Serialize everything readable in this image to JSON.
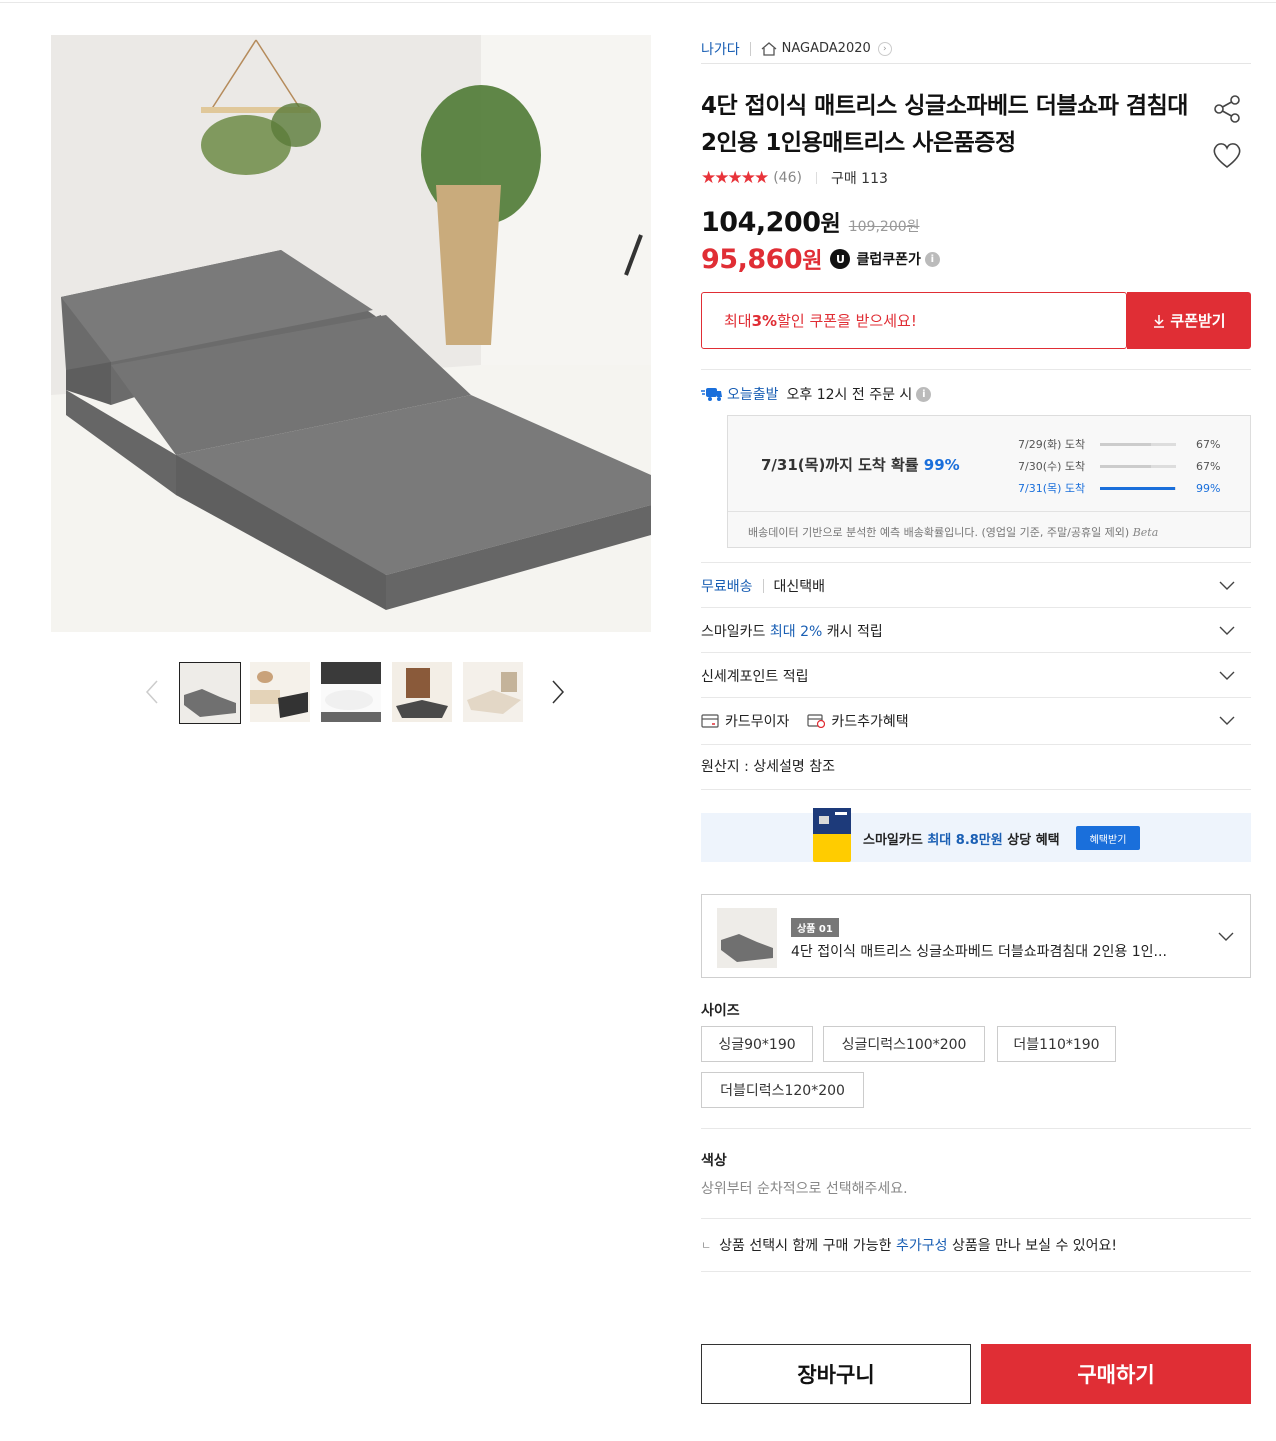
{
  "seller": {
    "brand": "나가다",
    "store": "NAGADA2020"
  },
  "product": {
    "title": "4단 접이식 매트리스 싱글소파베드 더블쇼파 겸침대 2인용 1인용매트리스 사은품증정",
    "rating_stars": "★★★★★",
    "rating_value": 4.5,
    "review_count": "(46)",
    "purchases": "구매 113"
  },
  "price": {
    "sale": "104,200",
    "sale_unit": "원",
    "original": "109,200원",
    "coupon": "95,860",
    "coupon_unit": "원",
    "coupon_badge": "U",
    "coupon_label": "클럽쿠폰가",
    "info_icon": "i"
  },
  "coupon_banner": {
    "prefix": "최대 ",
    "percent": "3%",
    "suffix": " 할인 쿠폰을 받으세요!",
    "button": "쿠폰받기"
  },
  "shipping": {
    "today_label": "오늘출발",
    "today_text": "오후 12시 전 주문 시",
    "arrival_prefix": "7/31(목)까지 도착 확률 ",
    "arrival_pct": "99%",
    "rows": [
      {
        "date": "7/29(화) 도착",
        "pct": "67%",
        "value": 67
      },
      {
        "date": "7/30(수) 도착",
        "pct": "67%",
        "value": 67
      },
      {
        "date": "7/31(목) 도착",
        "pct": "99%",
        "value": 99
      }
    ],
    "note": "배송데이터 기반으로 분석한 예측 배송확률입니다. (영업일 기준, 주말/공휴일 제외)",
    "beta": "Beta"
  },
  "benefits": {
    "free_ship": "무료배송",
    "courier": "대신택배",
    "smile_prefix": "스마일카드 ",
    "smile_blue": "최대 2%",
    "smile_suffix": " 캐시 적립",
    "shinsegae": "신세계포인트 적립",
    "card_interest": "카드무이자",
    "card_extra": "카드추가혜택",
    "origin": "원산지 : 상세설명 참조"
  },
  "smile_banner": {
    "prefix": "스마일카드 ",
    "blue": "최대 8.8만원",
    "suffix": " 상당 혜택",
    "button": "혜택받기"
  },
  "selected_item": {
    "tag": "상품 01",
    "name": "4단 접이식 매트리스 싱글소파베드 더블쇼파겸침대 2인용 1인..."
  },
  "options": {
    "size_label": "사이즈",
    "sizes": [
      "싱글90*190",
      "싱글디럭스100*200",
      "더블110*190",
      "더블디럭스120*200"
    ],
    "color_label": "색상",
    "color_guide": "상위부터 순차적으로 선택해주세요."
  },
  "addon": {
    "corner": "ㄴ",
    "prefix": "상품 선택시 함께 구매 가능한 ",
    "blue": "추가구성",
    "suffix": " 상품을 만나 보실 수 있어요!"
  },
  "actions": {
    "cart": "장바구니",
    "buy": "구매하기"
  },
  "colors": {
    "accent_red": "#e02e35",
    "link_blue": "#1a5fb4",
    "info_blue": "#1a6fdb"
  }
}
